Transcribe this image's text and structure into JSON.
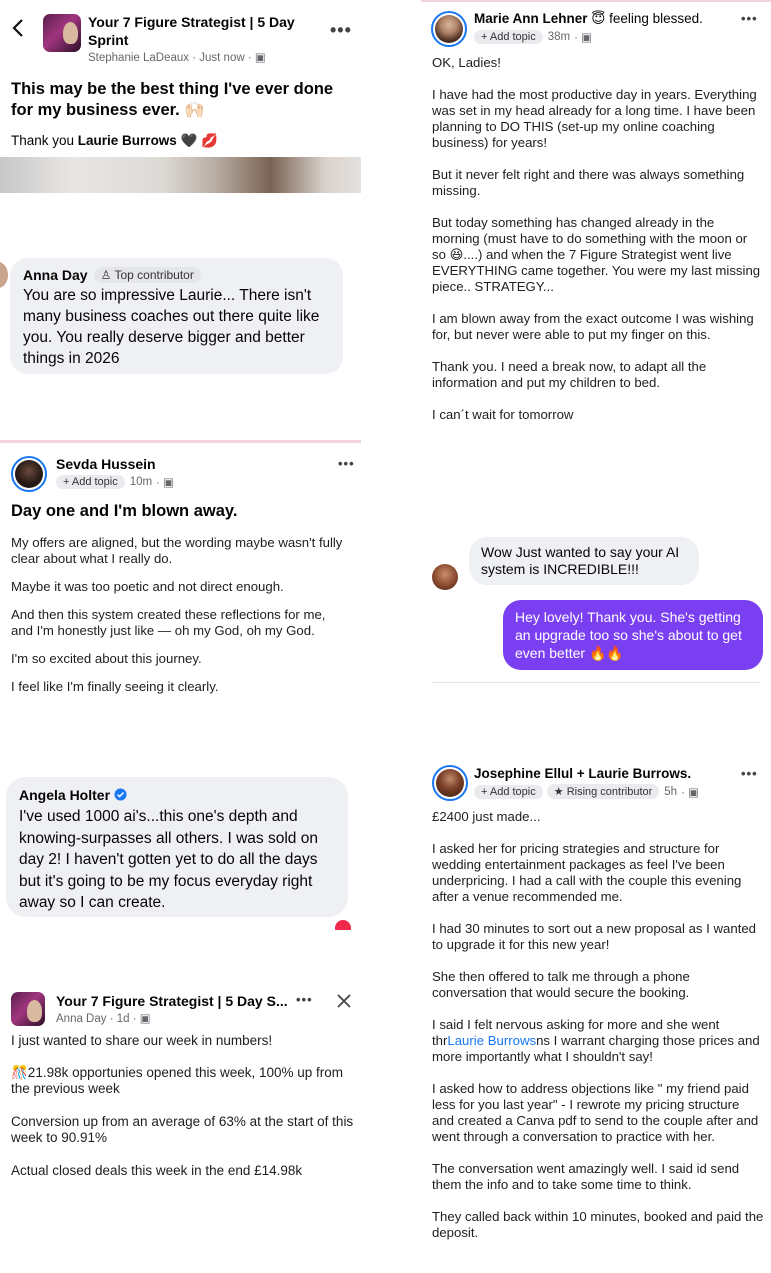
{
  "panel1": {
    "group_title": "Your 7 Figure Strategist | 5 Day Sprint",
    "author": "Stephanie LaDeaux",
    "time": "Just now",
    "heading": "This may be the best thing I've ever done for my business ever. 🙌🏻",
    "thanks_prefix": "Thank you ",
    "thanks_name": "Laurie Burrows",
    "thanks_emoji": "🖤 💋"
  },
  "comment_anna": {
    "name": "Anna Day",
    "badge": "Top contributor",
    "text": "You are so impressive Laurie... There isn't many business coaches out there quite like you. You really deserve bigger and better things in 2026"
  },
  "post_sevda": {
    "name": "Sevda Hussein",
    "topic": "+ Add topic",
    "time": "10m",
    "heading": "Day one and I'm blown away.",
    "paragraphs": [
      "My offers are aligned, but the wording maybe wasn't fully clear about what I really do.",
      "Maybe it was too poetic and not direct enough.",
      "And then this system created these reflections for me, and I'm honestly just like — oh my God, oh my God.",
      "I'm so excited about this journey.",
      "I feel like I'm finally seeing it clearly."
    ]
  },
  "comment_angela": {
    "name": "Angela Holter",
    "text": "I've used 1000 ai's...this one's depth and knowing-surpasses all others. I was sold on day 2! I haven't gotten yet to do all the days but it's going to be my focus everyday right away so I can create."
  },
  "post_stats": {
    "group_title": "Your 7 Figure Strategist | 5 Day S...",
    "author": "Anna Day",
    "time": "1d",
    "intro": "I just wanted to share our week in numbers!",
    "p1": "🎊21.98k opportunies opened this week, 100% up from the previous week",
    "p2": "Conversion up from an average of 63% at the start of this week to 90.91%",
    "p3": "Actual closed deals this week in the end £14.98k"
  },
  "post_marie": {
    "name": "Marie Ann Lehner",
    "feeling": "😇 feeling blessed.",
    "topic": "+ Add topic",
    "time": "38m",
    "paragraphs": [
      "OK, Ladies!",
      "I have had the most productive day in years. Everything was set in my head already for a long time. I have been planning to DO THIS (set-up my online coaching business) for years!",
      "But it never felt right and there was always something missing.",
      "But today something has changed already in the morning (must have to do something with the moon or so 😆....) and when the 7 Figure Strategist went live EVERYTHING came together. You were my last missing piece.. STRATEGY...",
      "I am blown away from the exact outcome I was wishing for, but never were able to put my finger on this.",
      "Thank you. I need a break now, to adapt all the information and put my children to bed.",
      "I can´t wait for tomorrow"
    ]
  },
  "chat": {
    "incoming": "Wow Just wanted to say your AI system is INCREDIBLE!!!",
    "outgoing": "Hey lovely! Thank you. She's getting an upgrade too so she's about to get even better 🔥🔥"
  },
  "post_josephine": {
    "name": "Josephine Ellul + Laurie Burrows.",
    "topic": "+ Add topic",
    "badge": "Rising contributor",
    "time": "5h",
    "paragraphs": [
      "£2400 just made...",
      "I asked her for pricing strategies and structure for wedding entertainment packages as feel I've been underpricing. I had a call with the couple this evening after a venue recommended me.",
      "I had 30 minutes to sort out a new proposal as I wanted to upgrade it for this new year!",
      "She then offered to talk me through a phone conversation that would secure the booking."
    ],
    "p5_a": "I said I felt nervous asking for more and she went thr",
    "p5_link": "Laurie Burrows",
    "p5_b": "ns I warrant charging those prices and more importantly what I shouldn't say!",
    "paragraphs2": [
      "I asked how to address objections like \" my friend paid less for you last year\" - I rewrote my pricing structure and created a Canva pdf to send to the couple after and went through a conversation to practice with her.",
      "The conversation went amazingly well. I said id send them the info and to take some time to think.",
      "They called back within 10 minutes, booked and paid the deposit."
    ]
  },
  "colors": {
    "accent_purple": "#7b3ff2",
    "fb_blue": "#1877f2",
    "pink_divider": "#f6d4dd",
    "bubble_grey": "#eef0f3"
  }
}
